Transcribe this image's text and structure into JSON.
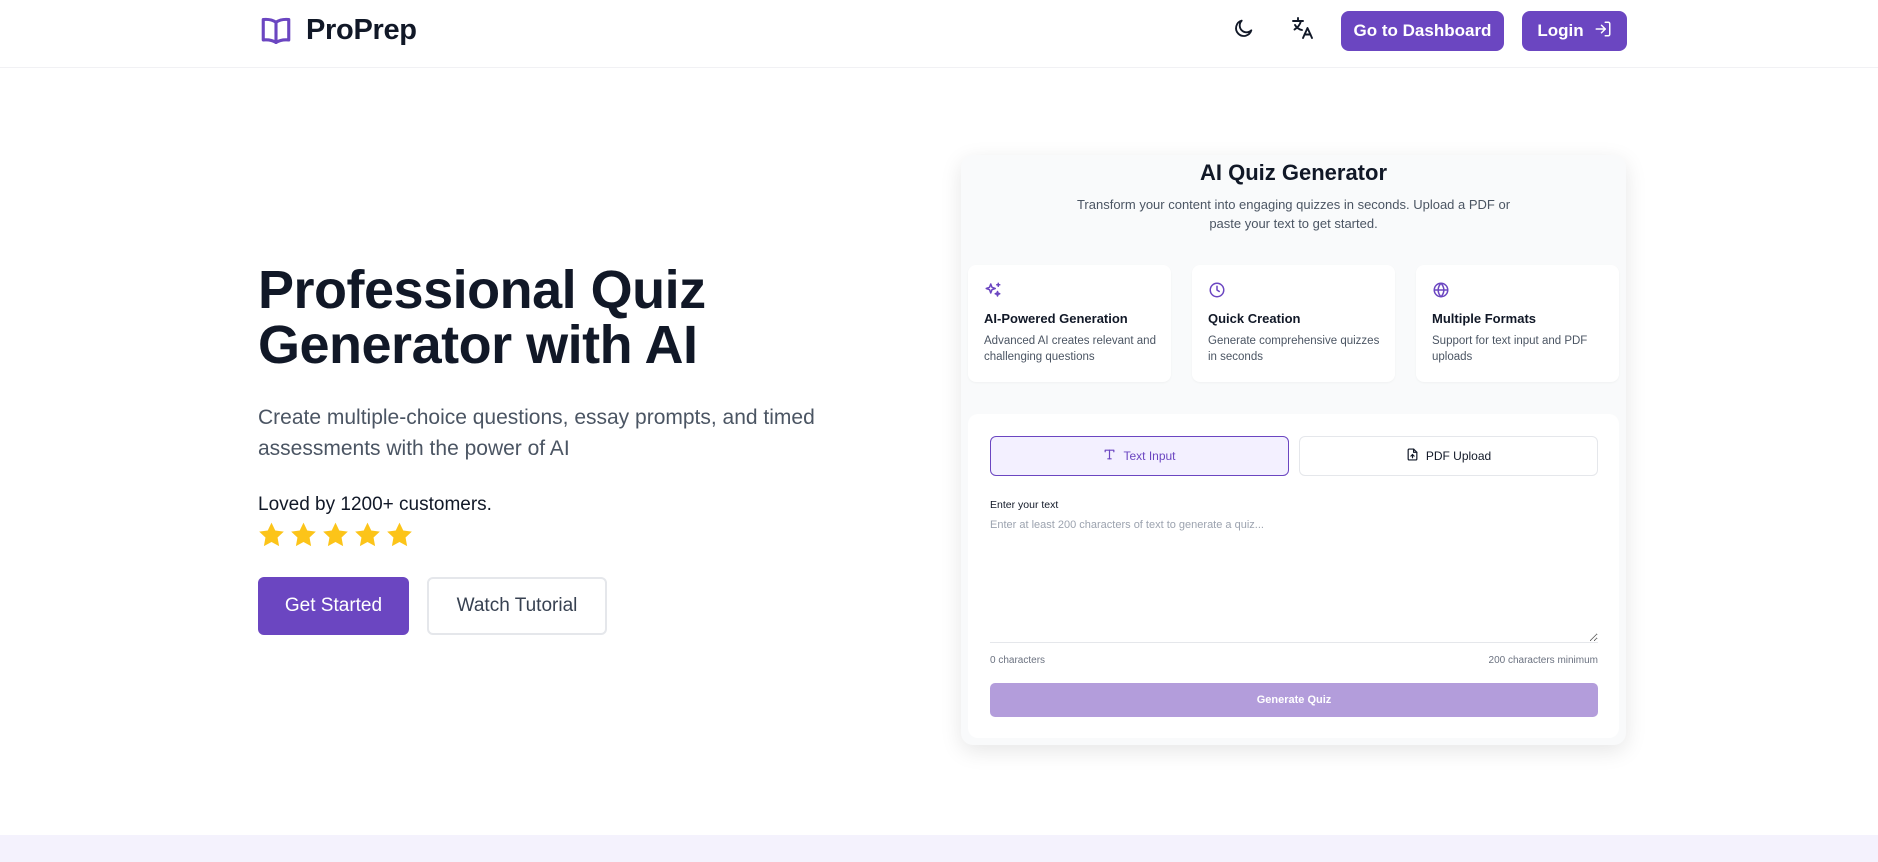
{
  "header": {
    "brand": "ProPrep",
    "icons": {
      "logo": "book-icon",
      "theme": "moon-icon",
      "language": "translate-icon",
      "login": "login-arrow-icon"
    },
    "dashboard_label": "Go to Dashboard",
    "login_label": "Login"
  },
  "hero": {
    "title": "Professional Quiz Generator with AI",
    "subtitle": "Create multiple-choice questions, essay prompts, and timed assessments with the power of AI",
    "loved": "Loved by 1200+ customers.",
    "rating": 5,
    "rating_max": 5,
    "get_started_label": "Get Started",
    "watch_label": "Watch Tutorial"
  },
  "card": {
    "title": "AI Quiz Generator",
    "description": "Transform your content into engaging quizzes in seconds. Upload a PDF or paste your text to get started.",
    "features": [
      {
        "icon": "sparkles-icon",
        "title": "AI-Powered Generation",
        "desc": "Advanced AI creates relevant and challenging questions"
      },
      {
        "icon": "clock-icon",
        "title": "Quick Creation",
        "desc": "Generate comprehensive quizzes in seconds"
      },
      {
        "icon": "globe-icon",
        "title": "Multiple Formats",
        "desc": "Support for text input and PDF uploads"
      }
    ],
    "tabs": [
      {
        "label": "Text Input",
        "icon": "text-type-icon",
        "active": true
      },
      {
        "label": "PDF Upload",
        "icon": "file-upload-icon",
        "active": false
      }
    ],
    "field_label": "Enter your text",
    "placeholder": "Enter at least 200 characters of text to generate a quiz...",
    "value": "",
    "char_count": "0 characters",
    "char_min": "200 characters minimum",
    "generate_label": "Generate Quiz"
  },
  "colors": {
    "accent": "#6b46c1",
    "accent_disabled": "#b39ddb",
    "star": "#fcc419",
    "text": "#111827",
    "muted": "#4b5563"
  }
}
